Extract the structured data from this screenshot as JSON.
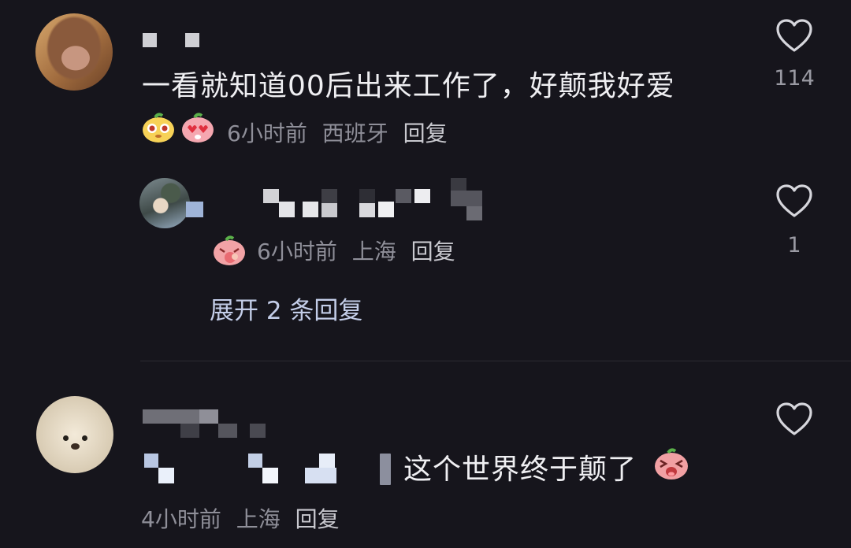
{
  "comments": [
    {
      "text": "一看就知道00后出来工作了，好颠我好爱",
      "meta": {
        "time": "6小时前",
        "location": "西班牙",
        "reply": "回复"
      },
      "likes": "114",
      "emojis": [
        "yellow-fruit-emoji",
        "pink-heart-eyes-emoji"
      ]
    },
    {
      "meta": {
        "time": "6小时前",
        "location": "上海",
        "reply": "回复"
      },
      "likes": "1",
      "emojis": [
        "pink-peach-emoji"
      ]
    },
    {
      "text": "这个世界终于颠了",
      "meta": {
        "time": "4小时前",
        "location": "上海",
        "reply": "回复"
      },
      "emojis": [
        "pink-laugh-emoji"
      ]
    }
  ],
  "expand_replies": "展开 2 条回复",
  "colors": {
    "background": "#16151c",
    "meta": "#8f8f99",
    "expand": "#c3cde8"
  }
}
